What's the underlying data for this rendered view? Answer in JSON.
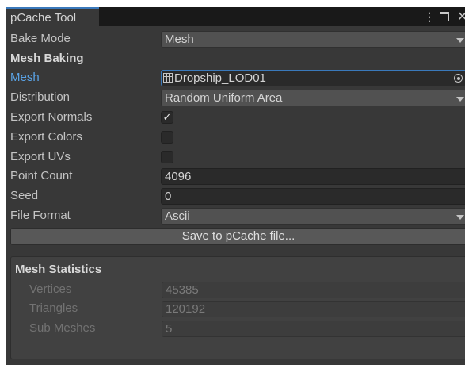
{
  "window": {
    "tab_title": "pCache Tool"
  },
  "bake_mode": {
    "label": "Bake Mode",
    "value": "Mesh"
  },
  "mesh_baking": {
    "header": "Mesh Baking",
    "mesh": {
      "label": "Mesh",
      "value": "Dropship_LOD01",
      "icon": "mesh-icon"
    },
    "distribution": {
      "label": "Distribution",
      "value": "Random Uniform Area"
    },
    "export_normals": {
      "label": "Export Normals",
      "checked": true,
      "check_glyph": "✓"
    },
    "export_colors": {
      "label": "Export Colors",
      "checked": false
    },
    "export_uvs": {
      "label": "Export UVs",
      "checked": false
    },
    "point_count": {
      "label": "Point Count",
      "value": "4096"
    },
    "seed": {
      "label": "Seed",
      "value": "0"
    },
    "file_format": {
      "label": "File Format",
      "value": "Ascii"
    }
  },
  "save_button": "Save to pCache file...",
  "mesh_statistics": {
    "header": "Mesh Statistics",
    "vertices": {
      "label": "Vertices",
      "value": "45385"
    },
    "triangles": {
      "label": "Triangles",
      "value": "120192"
    },
    "sub_meshes": {
      "label": "Sub Meshes",
      "value": "5"
    }
  },
  "colors": {
    "panel_bg": "#383838",
    "accent": "#3a79bb",
    "active_label": "#5aa3e6"
  }
}
